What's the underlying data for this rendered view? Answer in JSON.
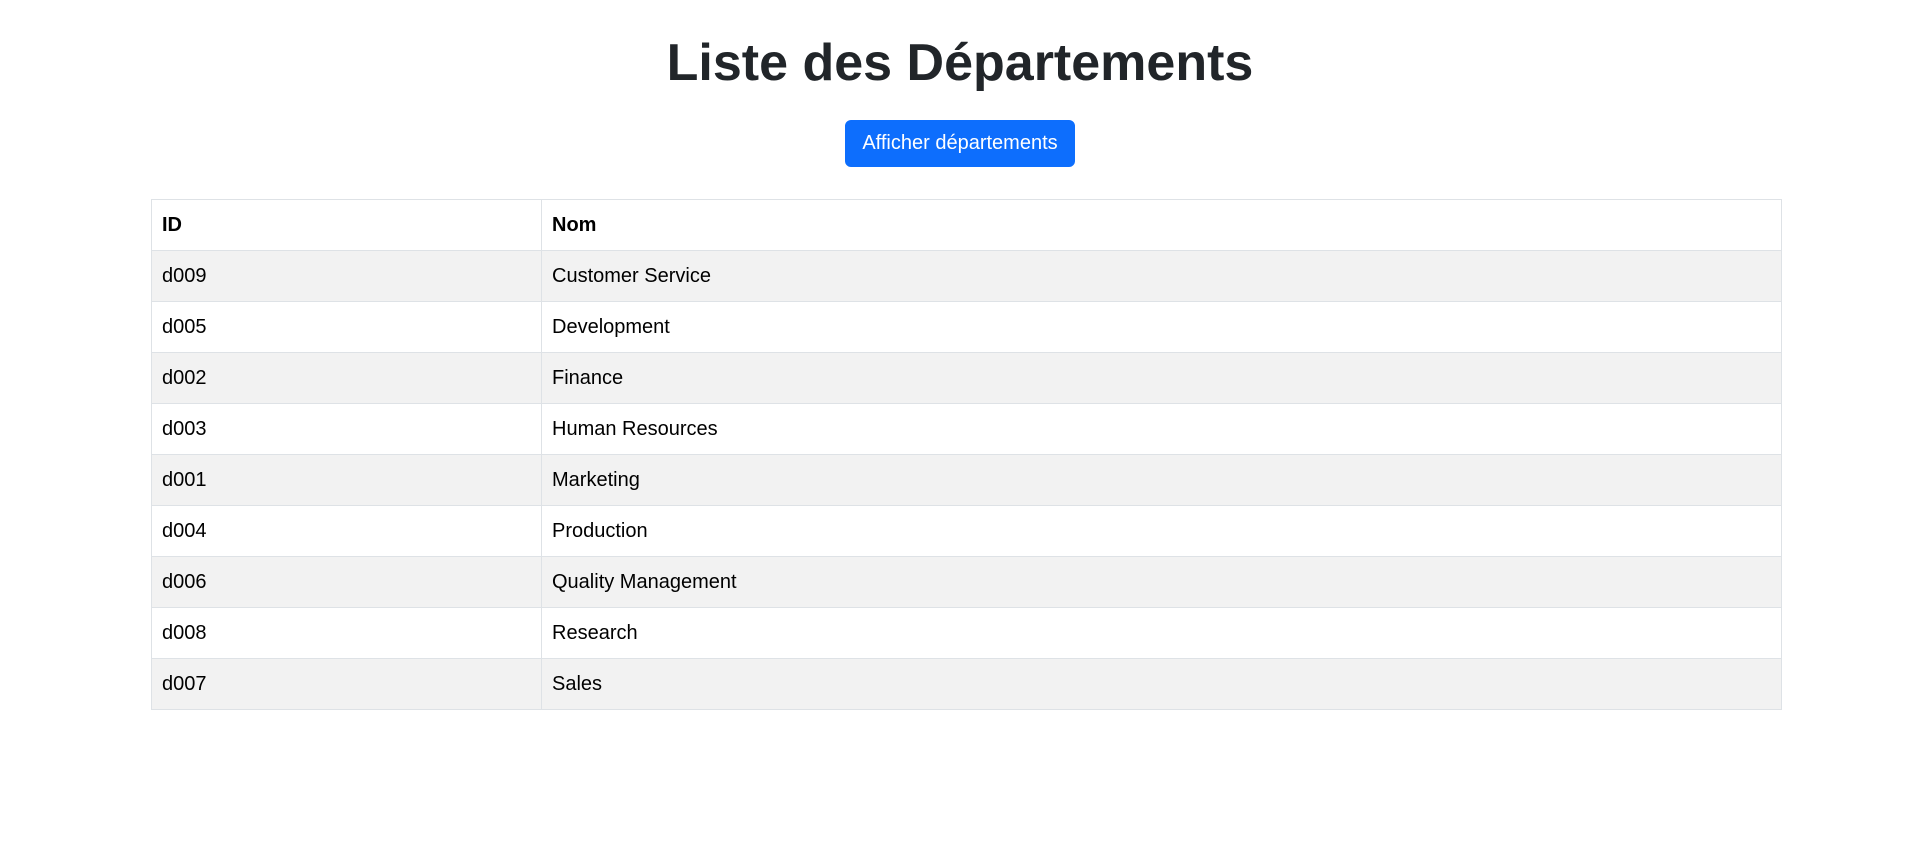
{
  "page": {
    "title": "Liste des Départements"
  },
  "actions": {
    "show_departments_label": "Afficher départements"
  },
  "table": {
    "headers": {
      "id": "ID",
      "name": "Nom"
    },
    "rows": [
      {
        "id": "d009",
        "name": "Customer Service"
      },
      {
        "id": "d005",
        "name": "Development"
      },
      {
        "id": "d002",
        "name": "Finance"
      },
      {
        "id": "d003",
        "name": "Human Resources"
      },
      {
        "id": "d001",
        "name": "Marketing"
      },
      {
        "id": "d004",
        "name": "Production"
      },
      {
        "id": "d006",
        "name": "Quality Management"
      },
      {
        "id": "d008",
        "name": "Research"
      },
      {
        "id": "d007",
        "name": "Sales"
      }
    ]
  },
  "colors": {
    "primary_button": "#0d6efd",
    "striped_row": "#f2f2f2",
    "border": "#dee2e6",
    "title_text": "#212529"
  }
}
